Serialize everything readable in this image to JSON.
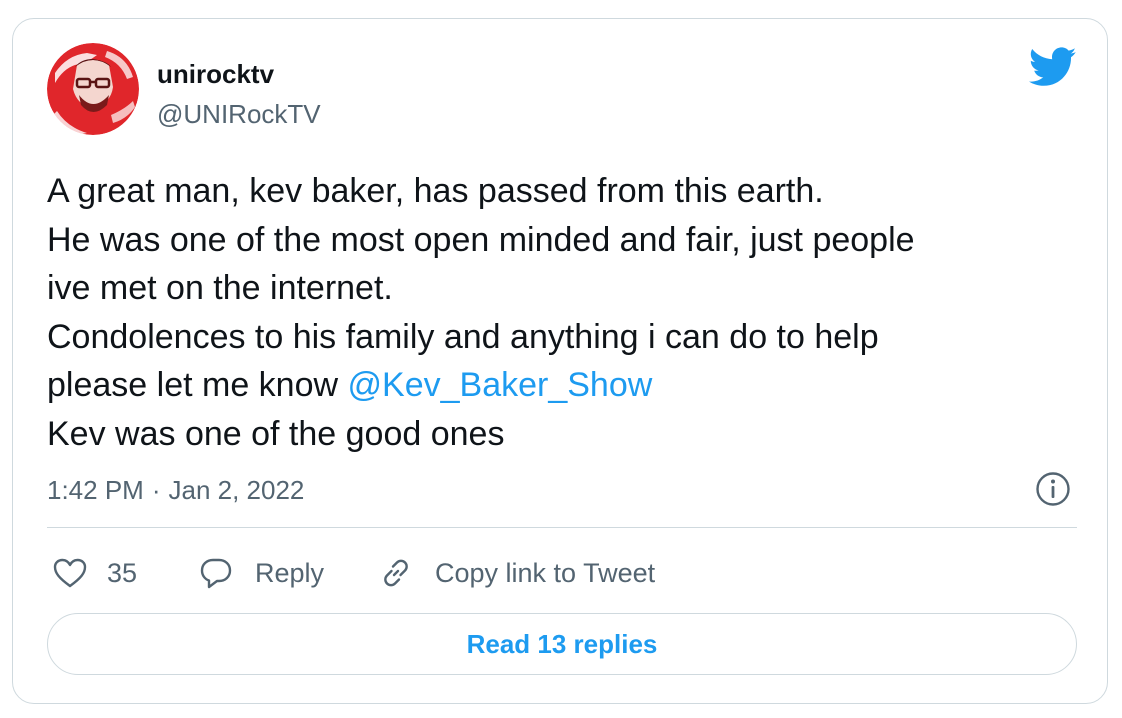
{
  "author": {
    "display_name": "unirocktv",
    "handle": "@UNIRockTV",
    "avatar_icon": "avatar-portrait"
  },
  "tweet": {
    "lines": [
      "A great man, kev baker, has passed from this earth.",
      "He was one of the most open minded and fair, just people",
      "ive met on the internet.",
      "Condolences to his family and anything i can do to help",
      "please let me know ",
      "Kev was one of the good ones"
    ],
    "mention": "@Kev_Baker_Show",
    "time": "1:42 PM",
    "separator": "·",
    "date": "Jan 2, 2022"
  },
  "actions": {
    "like_count": "35",
    "reply_label": "Reply",
    "copy_label": "Copy link to Tweet",
    "read_replies_label": "Read 13 replies"
  },
  "icons": {
    "brand": "twitter-bird-icon",
    "info": "info-icon",
    "like": "heart-icon",
    "reply": "speech-bubble-icon",
    "copy": "link-icon"
  },
  "colors": {
    "accent": "#1d9bf0",
    "text_primary": "#0f1419",
    "text_secondary": "#536471",
    "border": "#cfd9de",
    "avatar_red": "#e0262b"
  }
}
